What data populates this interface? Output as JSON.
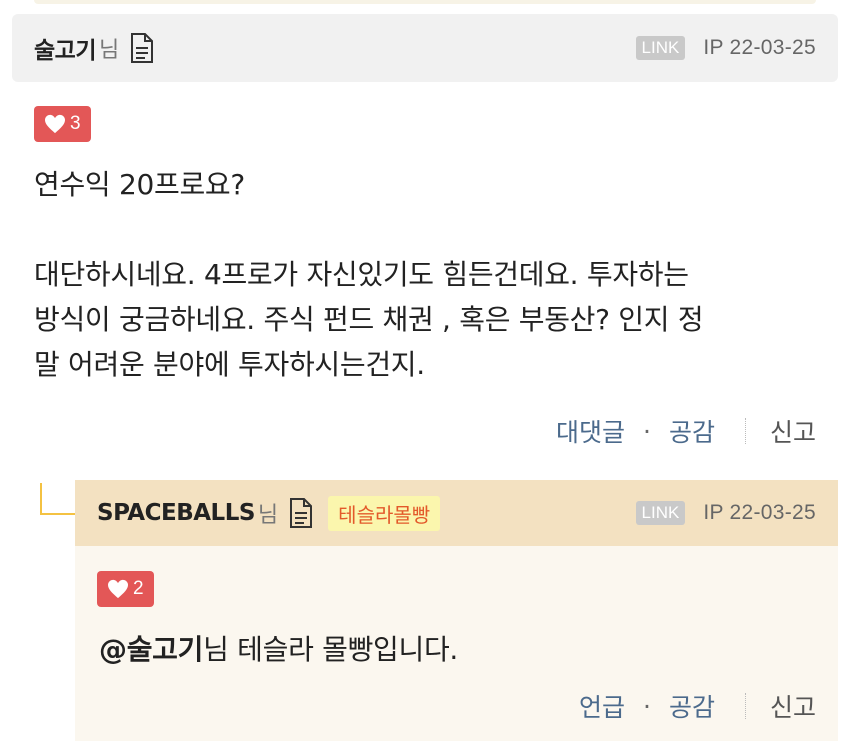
{
  "comment": {
    "nickname": "술고기",
    "honorific": "님",
    "link_badge": "LINK",
    "meta": "IP 22-03-25",
    "likes": "3",
    "body_line1": "연수익 20프로요?",
    "body_line2": "대단하시네요. 4프로가 자신있기도 힘든건데요. 투자하는",
    "body_line3": "방식이 궁금하네요. 주식 펀드 채권 , 혹은 부동산? 인지 정",
    "body_line4": "말 어려운 분야에 투자하시는건지.",
    "actions": {
      "reply": "대댓글",
      "dot": "·",
      "like": "공감",
      "report": "신고"
    }
  },
  "reply": {
    "nickname": "SPACEBALLS",
    "honorific": "님",
    "tag": "테슬라몰빵",
    "link_badge": "LINK",
    "meta": "IP 22-03-25",
    "likes": "2",
    "mention": "@술고기",
    "mention_suffix": "님 테슬라 몰빵입니다.",
    "actions": {
      "mention": "언급",
      "dot": "·",
      "like": "공감",
      "report": "신고"
    }
  },
  "icons": {
    "document": "document-icon",
    "heart": "heart-icon"
  },
  "colors": {
    "like_badge": "#e35757",
    "action_link": "#4b6a8c",
    "reply_header": "#f3e1c1",
    "tag_bg": "#fbf6ad",
    "tag_text": "#e3592a"
  }
}
